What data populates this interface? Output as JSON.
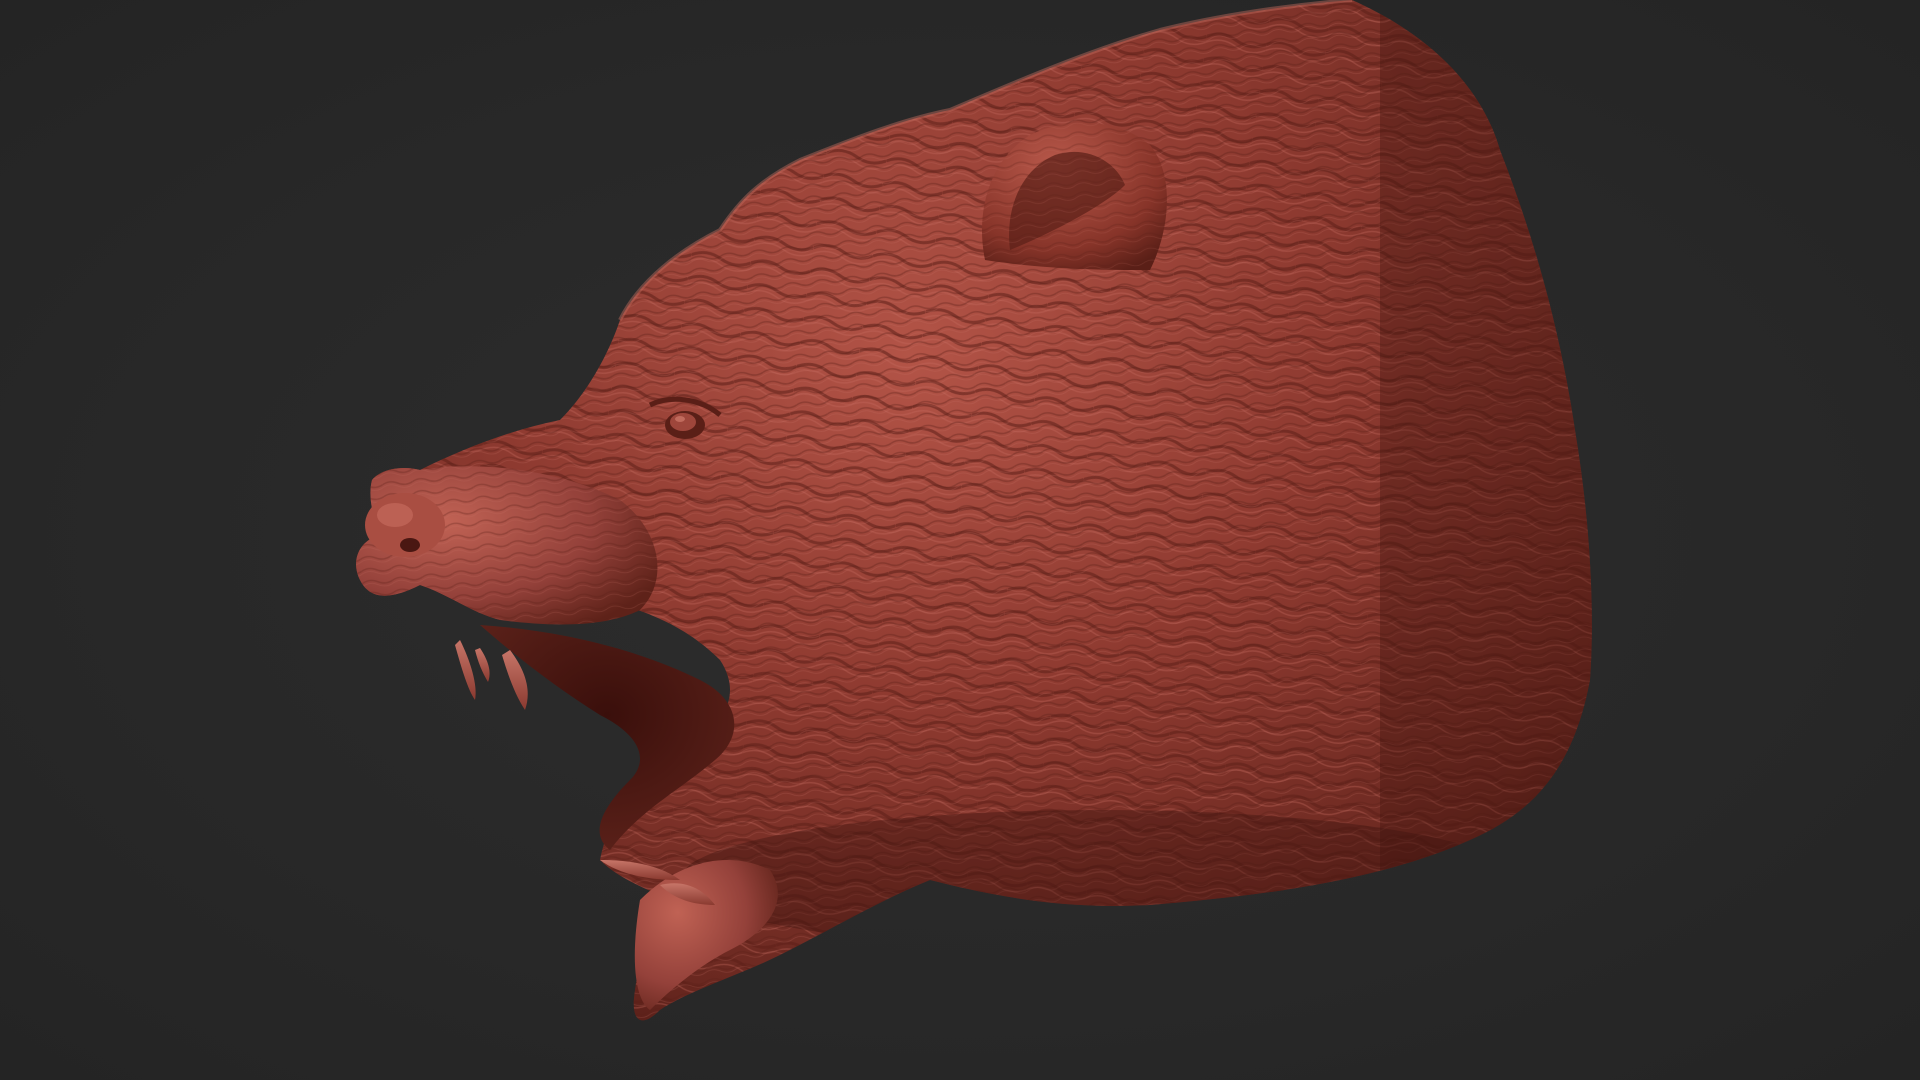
{
  "scene": {
    "subject": "bear-head-sculpt",
    "background_color": "#282828",
    "material_color": "#8e3a30",
    "material_highlight": "#c46a5c",
    "material_shadow": "#4a1712",
    "teeth_color": "#b8665a"
  }
}
